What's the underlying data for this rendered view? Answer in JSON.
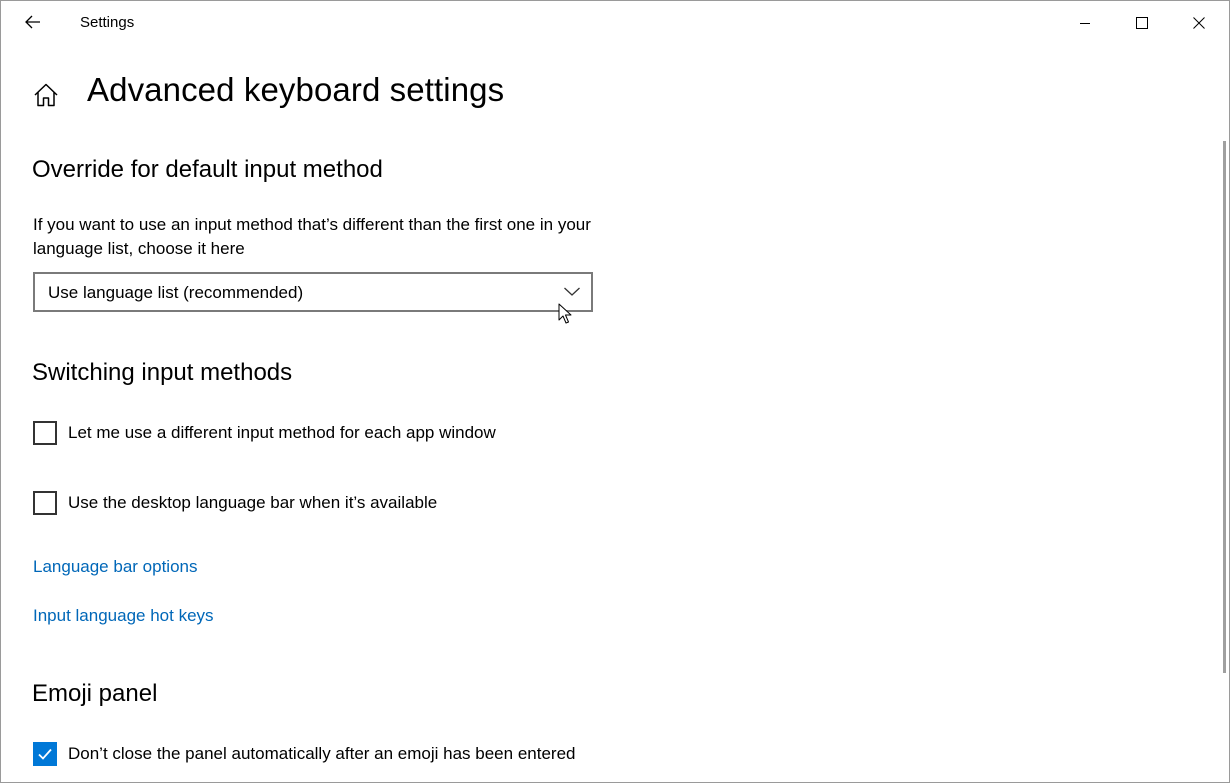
{
  "titlebar": {
    "back_icon": "arrow-left-icon",
    "title": "Settings",
    "minimize_icon": "minimize-icon",
    "maximize_icon": "maximize-icon",
    "close_icon": "close-icon"
  },
  "header": {
    "home_icon": "home-icon",
    "title": "Advanced keyboard settings"
  },
  "override_section": {
    "heading": "Override for default input method",
    "description": "If you want to use an input method that’s different than the first one in your language list, choose it here",
    "dropdown": {
      "selected": "Use language list (recommended)",
      "icon": "chevron-down-icon"
    }
  },
  "switching_section": {
    "heading": "Switching input methods",
    "checkboxes": [
      {
        "label": "Let me use a different input method for each app window",
        "checked": false
      },
      {
        "label": "Use the desktop language bar when it’s available",
        "checked": false
      }
    ],
    "links": [
      {
        "label": "Language bar options"
      },
      {
        "label": "Input language hot keys"
      }
    ]
  },
  "emoji_section": {
    "heading": "Emoji panel",
    "checkboxes": [
      {
        "label": "Don’t close the panel automatically after an emoji has been entered",
        "checked": true
      }
    ]
  },
  "colors": {
    "accent": "#0078d7",
    "link": "#0067b8",
    "border": "#7a7a7a"
  }
}
